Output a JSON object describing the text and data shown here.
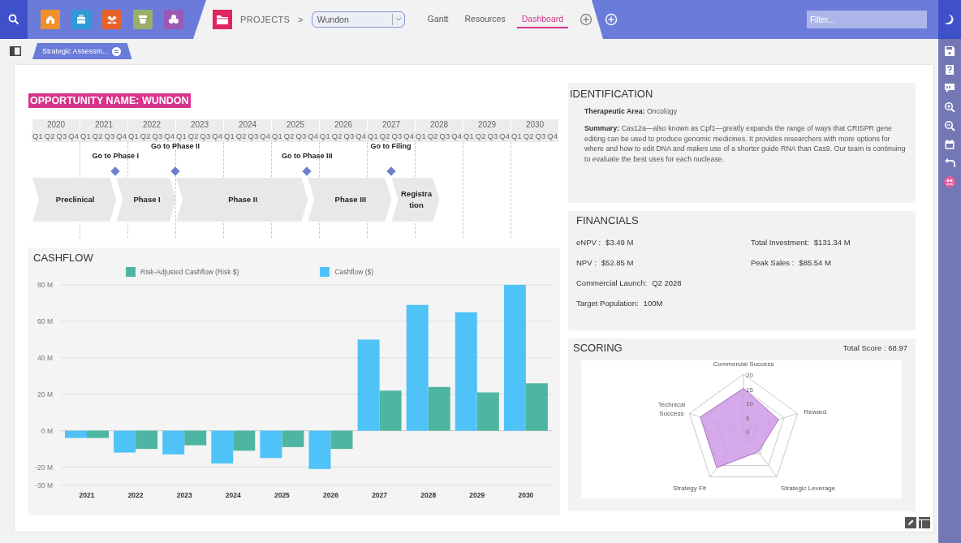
{
  "toolbar": {
    "breadcrumb": "PROJECTS",
    "breadcrumb_separator": ">",
    "project_select": {
      "value": "Wundon"
    },
    "tabs": [
      {
        "label": "Gantt",
        "selected": false
      },
      {
        "label": "Resources",
        "selected": false
      },
      {
        "label": "Dashboard",
        "selected": true
      }
    ],
    "filter": {
      "placeholder": "Filter..."
    }
  },
  "view_tabs": [
    {
      "label": "Strategic Assessm...",
      "selected": true
    }
  ],
  "opportunity": {
    "title": "OPPORTUNITY NAME: WUNDON"
  },
  "timeline": {
    "years": [
      {
        "year": "2020",
        "quarters": [
          "Q1",
          "Q2",
          "Q3",
          "Q4"
        ]
      },
      {
        "year": "2021",
        "quarters": [
          "Q1",
          "Q2",
          "Q3",
          "Q4"
        ]
      },
      {
        "year": "2022",
        "quarters": [
          "Q1",
          "Q2",
          "Q3",
          "Q4"
        ]
      },
      {
        "year": "2023",
        "quarters": [
          "Q1",
          "Q2",
          "Q3",
          "Q4"
        ]
      },
      {
        "year": "2024",
        "quarters": [
          "Q1",
          "Q2",
          "Q3",
          "Q4"
        ]
      },
      {
        "year": "2025",
        "quarters": [
          "Q1",
          "Q2",
          "Q3",
          "Q4"
        ]
      },
      {
        "year": "2026",
        "quarters": [
          "Q1",
          "Q2",
          "Q3",
          "Q4"
        ]
      },
      {
        "year": "2027",
        "quarters": [
          "Q1",
          "Q2",
          "Q3",
          "Q4"
        ]
      },
      {
        "year": "2028",
        "quarters": [
          "Q1",
          "Q2",
          "Q3",
          "Q4"
        ]
      },
      {
        "year": "2029",
        "quarters": [
          "Q1",
          "Q2",
          "Q3",
          "Q4"
        ]
      },
      {
        "year": "2030",
        "quarters": [
          "Q1",
          "Q2",
          "Q3",
          "Q4"
        ]
      }
    ],
    "phases": [
      {
        "label": "Preclinical"
      },
      {
        "label": "Phase I"
      },
      {
        "label": "Phase II"
      },
      {
        "label": "Phase III"
      },
      {
        "label": "Registration"
      }
    ],
    "milestones": [
      {
        "label": "Go to Phase I"
      },
      {
        "label": "Go to Phase II"
      },
      {
        "label": "Go to Phase III"
      },
      {
        "label": "Go to Filing"
      }
    ]
  },
  "cashflow": {
    "title": "CASHFLOW",
    "chart_data": {
      "type": "bar",
      "categories": [
        "2021",
        "2022",
        "2023",
        "2024",
        "2025",
        "2026",
        "2027",
        "2028",
        "2029",
        "2030"
      ],
      "series": [
        {
          "name": "Risk-Adjusted Cashflow (Risk $)",
          "color": "#4db6a2",
          "values": [
            -4,
            -10,
            -8,
            -11,
            -9,
            -10,
            22,
            24,
            21,
            26
          ]
        },
        {
          "name": "Cashflow ($)",
          "color": "#4fc3f7",
          "values": [
            -4,
            -12,
            -13,
            -18,
            -15,
            -21,
            50,
            69,
            65,
            80
          ]
        }
      ],
      "ylim": [
        -30,
        80
      ],
      "grid": true,
      "legend": "top",
      "yticks": [
        {
          "value": 80,
          "label": "80 M"
        },
        {
          "value": 60,
          "label": "60 M"
        },
        {
          "value": 40,
          "label": "40 M"
        },
        {
          "value": 20,
          "label": "20 M"
        },
        {
          "value": 0,
          "label": "0 M"
        },
        {
          "value": -20,
          "label": "-20 M"
        },
        {
          "value": -30,
          "label": "-30 M"
        }
      ]
    }
  },
  "identification": {
    "title": "IDENTIFICATION",
    "lines": [
      "**Therapeutic Area:** Oncology",
      "**Summary:** Cas12a—also known as Cpf1—greatly expands the range of ways that CRISPR gene editing can be used to produce genomic medicines. It provides researchers with more options for where and how to edit DNA and makes use of a shorter guide RNA than Cas9. Our team is continuing to evaluate the best uses for each nuclease."
    ]
  },
  "financials": {
    "title": "FINANCIALS",
    "rows": [
      [
        {
          "label": "eNPV :",
          "value": "$3.49 M"
        },
        {
          "label": "Total Investment:",
          "value": "$131.34 M"
        }
      ],
      [
        {
          "label": "NPV :",
          "value": "$52.85 M"
        },
        {
          "label": "Peak Sales :",
          "value": "$85.54 M"
        }
      ],
      [
        {
          "label": "Commercial Launch:",
          "value": "Q2 2028"
        }
      ],
      [
        {
          "label": "Target Population:",
          "value": "100M"
        }
      ]
    ]
  },
  "scoring": {
    "title": "SCORING",
    "total": "Total Score : 68.97",
    "radar": {
      "axes": [
        {
          "label": "Commercial Success"
        },
        {
          "label": "Technical Success"
        },
        {
          "label": "Reward"
        },
        {
          "label": "Strategy Fit"
        },
        {
          "label": "Strategic Leverage"
        }
      ],
      "scale_labels": [
        "20",
        "15",
        "10",
        "5",
        "0"
      ]
    }
  }
}
